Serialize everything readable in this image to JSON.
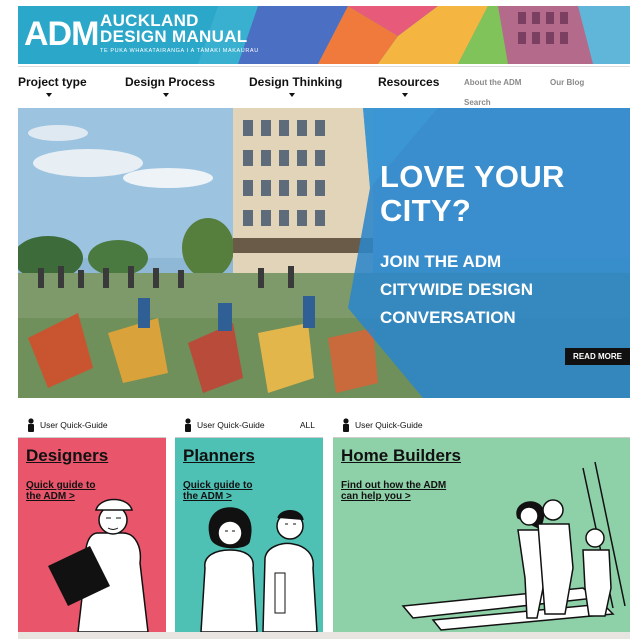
{
  "header": {
    "logo_mark": "ADM",
    "title_line1": "AUCKLAND",
    "title_line2": "DESIGN MANUAL",
    "subtitle": "TE PUKA WHAKATAIRANGA I A TĀMAKI MAKAURAU"
  },
  "nav": {
    "items": [
      {
        "label": "Project type"
      },
      {
        "label": "Design Process"
      },
      {
        "label": "Design Thinking"
      },
      {
        "label": "Resources"
      }
    ],
    "about": "About the ADM",
    "blog": "Our Blog",
    "search": "Search"
  },
  "hero": {
    "headline_line1": "LOVE YOUR",
    "headline_line2": "CITY?",
    "sub_line1": "JOIN THE ADM",
    "sub_line2": "CITYWIDE DESIGN",
    "sub_line3": "CONVERSATION",
    "read_more": "READ MORE"
  },
  "cards": [
    {
      "guide_label": "User Quick-Guide",
      "title": "Designers",
      "link_line1": "Quick guide to",
      "link_line2": "the ADM >",
      "color": "#e9566b"
    },
    {
      "guide_label": "User Quick-Guide",
      "all_label": "ALL",
      "title": "Planners",
      "link_line1": "Quick guide to",
      "link_line2": "the ADM >",
      "color": "#4fc0b4"
    },
    {
      "guide_label": "User Quick-Guide",
      "title": "Home Builders",
      "link_line1": "Find out how the ADM",
      "link_line2": "can help you >",
      "color": "#8ed1a8"
    }
  ],
  "colors": {
    "banner_blue": "#2aa7c9",
    "hero_overlay": "#2c86c9",
    "designers": "#e9566b",
    "planners": "#4fc0b4",
    "home_builders": "#8ed1a8"
  }
}
